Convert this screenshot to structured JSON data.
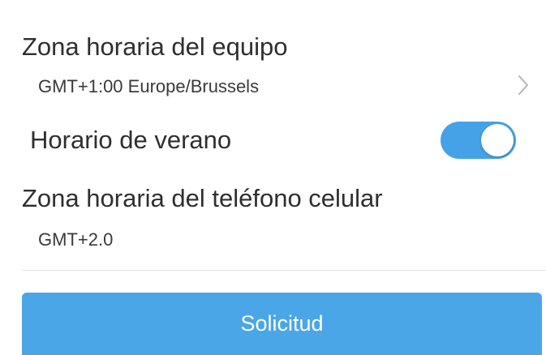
{
  "device_timezone": {
    "title": "Zona horaria del equipo",
    "value": "GMT+1:00 Europe/Brussels",
    "chevron_icon": "chevron-right-icon"
  },
  "daylight_saving": {
    "label": "Horario de verano",
    "enabled": true,
    "toggle_color": "#46a2e6"
  },
  "phone_timezone": {
    "title": "Zona horaria del teléfono celular",
    "value": "GMT+2.0"
  },
  "submit_button": {
    "label": "Solicitud",
    "color": "#4aa6e6"
  }
}
